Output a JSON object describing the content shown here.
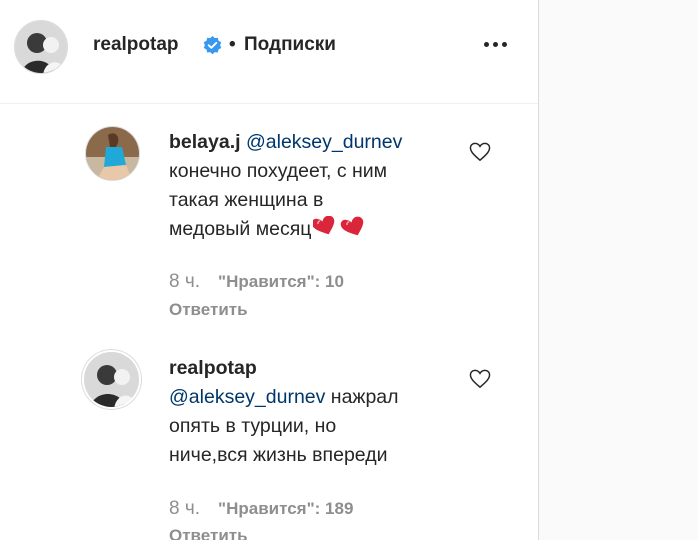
{
  "header": {
    "username": "realpotap",
    "separator": "•",
    "follow_status": "Подписки"
  },
  "colors": {
    "verified_badge": "#3897f0",
    "mention": "#00376b",
    "meta_gray": "#8e8e8e",
    "heart_emoji": "#d9263b"
  },
  "comments": [
    {
      "username": "belaya.j",
      "mention": "@aleksey_durnev",
      "lines": [
        "конечно похудеет, с ним",
        "такая женщина в",
        "медовый месяц"
      ],
      "emoji": "two-hearts",
      "time": "8 ч.",
      "likes": "\"Нравится\": 10",
      "reply": "Ответить"
    },
    {
      "username": "realpotap",
      "mention": "@aleksey_durnev",
      "first_line_rest": " нажрал",
      "lines": [
        "опять в турции, но",
        "ниче,вся жизнь впереди"
      ],
      "time": "8 ч.",
      "likes": "\"Нравится\": 189",
      "reply": "Ответить"
    }
  ]
}
